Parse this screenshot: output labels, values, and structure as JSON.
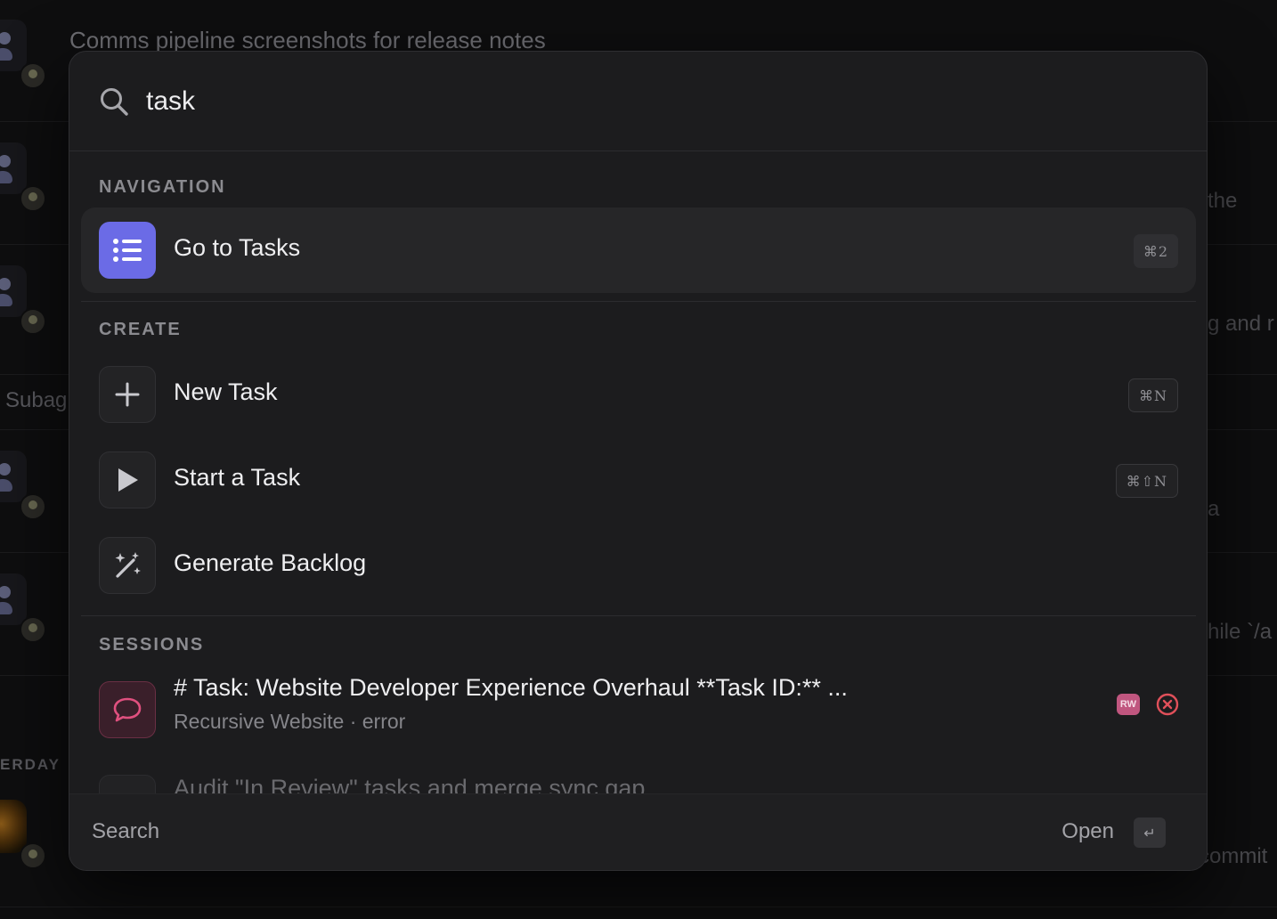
{
  "background": {
    "title": "Comms pipeline screenshots for release notes",
    "snippets": [
      "the",
      "g and r",
      "a",
      "hile `/a",
      "commit"
    ],
    "side_label": "Subag",
    "section_label": "ERDAY"
  },
  "search": {
    "value": "task",
    "icon": "search-icon"
  },
  "sections": {
    "navigation": "NAVIGATION",
    "create": "CREATE",
    "sessions": "SESSIONS"
  },
  "navigation": {
    "items": [
      {
        "label": "Go to Tasks",
        "shortcut": "⌘2",
        "icon": "list-icon"
      }
    ]
  },
  "create": {
    "items": [
      {
        "label": "New Task",
        "shortcut": "⌘N",
        "icon": "plus-icon"
      },
      {
        "label": "Start a Task",
        "shortcut": "⌘⇧N",
        "icon": "play-icon"
      },
      {
        "label": "Generate Backlog",
        "shortcut": "",
        "icon": "magic-wand-icon"
      }
    ]
  },
  "sessions": {
    "items": [
      {
        "title": "# Task: Website Developer Experience Overhaul **Task ID:** ...",
        "subtitle": "Recursive Website · error",
        "badge": "RW",
        "status": "error",
        "icon": "chat-bubble-icon"
      },
      {
        "title": "Audit \"In Review\" tasks and merge sync gap"
      }
    ]
  },
  "footer": {
    "left_label": "Search",
    "right_label": "Open",
    "enter_key": "↵"
  },
  "colors": {
    "accent": "#6b6be6",
    "session_accent": "#e0507f",
    "error": "#e0505a",
    "palette_bg": "#1c1c1e"
  }
}
